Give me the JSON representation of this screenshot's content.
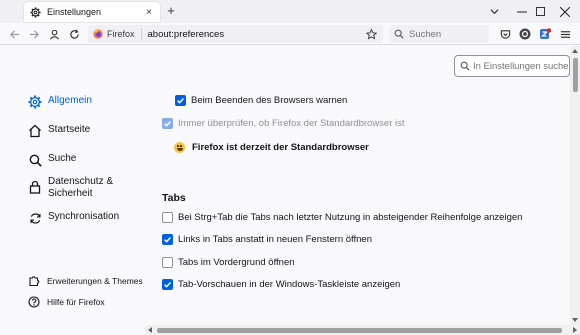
{
  "tab": {
    "title": "Einstellungen",
    "close": "×"
  },
  "newtab": "+",
  "nav": {
    "identity_label": "Firefox",
    "url": "about:preferences",
    "search_placeholder": "Suchen"
  },
  "find": {
    "placeholder": "In Einstellungen suchen"
  },
  "sidebar": {
    "items": [
      {
        "label": "Allgemein",
        "icon": "gear-icon",
        "selected": true
      },
      {
        "label": "Startseite",
        "icon": "home-icon"
      },
      {
        "label": "Suche",
        "icon": "search-icon"
      },
      {
        "label": "Datenschutz &",
        "label2": "Sicherheit",
        "icon": "lock-icon"
      },
      {
        "label": "Synchronisation",
        "icon": "sync-icon"
      }
    ],
    "footer": [
      {
        "label": "Erweiterungen & Themes",
        "icon": "puzzle-icon"
      },
      {
        "label": "Hilfe für Firefox",
        "icon": "help-icon"
      }
    ]
  },
  "prefs": {
    "warn_on_quit": {
      "label": "Beim Beenden des Browsers warnen",
      "checked": true
    },
    "check_default": {
      "label": "Immer überprüfen, ob Firefox der Standardbrowser ist",
      "checked": true,
      "disabled": true
    },
    "default_status": "Firefox ist derzeit der Standardbrowser"
  },
  "tabs_section": {
    "title": "Tabs",
    "options": [
      {
        "label": "Bei Strg+Tab die Tabs nach letzter Nutzung in absteigender Reihenfolge anzeigen",
        "checked": false
      },
      {
        "label": "Links in Tabs anstatt in neuen Fenstern öffnen",
        "checked": true
      },
      {
        "label": "Tabs im Vordergrund öffnen",
        "checked": false
      },
      {
        "label": "Tab-Vorschauen in der Windows-Taskleiste anzeigen",
        "checked": true
      }
    ]
  },
  "colors": {
    "accent": "#0061e0",
    "checkbox_disabled": "#85abea"
  }
}
